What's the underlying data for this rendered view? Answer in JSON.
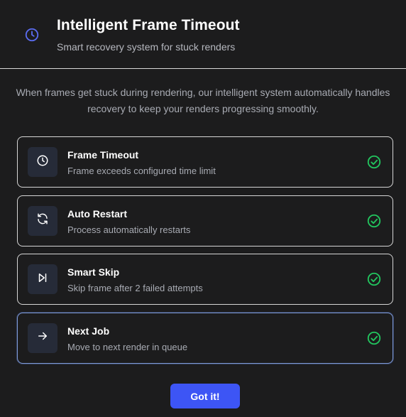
{
  "header": {
    "icon": "clock-icon",
    "title": "Intelligent Frame Timeout",
    "subtitle": "Smart recovery system for stuck renders"
  },
  "description": "When frames get stuck during rendering, our intelligent system automatically handles recovery to keep your renders progressing smoothly.",
  "steps": [
    {
      "icon": "clock-icon",
      "title": "Frame Timeout",
      "description": "Frame exceeds configured time limit",
      "status": "check-circle-icon"
    },
    {
      "icon": "refresh-icon",
      "title": "Auto Restart",
      "description": "Process automatically restarts",
      "status": "check-circle-icon"
    },
    {
      "icon": "skip-forward-icon",
      "title": "Smart Skip",
      "description": "Skip frame after 2 failed attempts",
      "status": "check-circle-icon"
    },
    {
      "icon": "arrow-right-icon",
      "title": "Next Job",
      "description": "Move to next render in queue",
      "status": "check-circle-icon"
    }
  ],
  "button": {
    "label": "Got it!"
  },
  "colors": {
    "background": "#1c1c1d",
    "accent": "#3d55f5",
    "header_icon": "#5b6cf0",
    "success": "#22c55e",
    "icon_box": "#262b38"
  }
}
